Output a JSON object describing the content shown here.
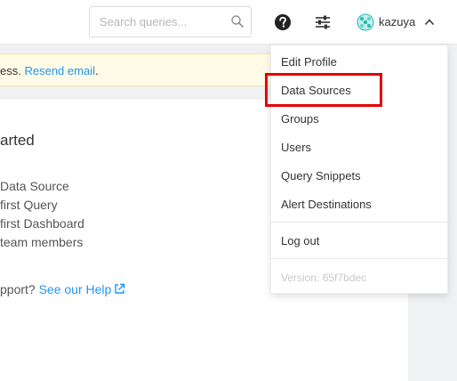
{
  "header": {
    "search_placeholder": "Search queries...",
    "user_name": "kazuya"
  },
  "notice": {
    "text": "ess.",
    "link": "Resend email",
    "suffix": "."
  },
  "main": {
    "title": "arted",
    "steps": [
      "Data Source",
      " first Query",
      " first Dashboard",
      "team members"
    ],
    "support_text": "pport?",
    "help_link": "See our Help"
  },
  "dropdown": {
    "items": [
      "Edit Profile",
      "Data Sources",
      "Groups",
      "Users",
      "Query Snippets",
      "Alert Destinations"
    ],
    "logout": "Log out",
    "version": "Version: 65f7bdec"
  },
  "colors": {
    "link": "#2196f3",
    "highlight": "#e60000",
    "notice_bg": "#fffbe6"
  }
}
